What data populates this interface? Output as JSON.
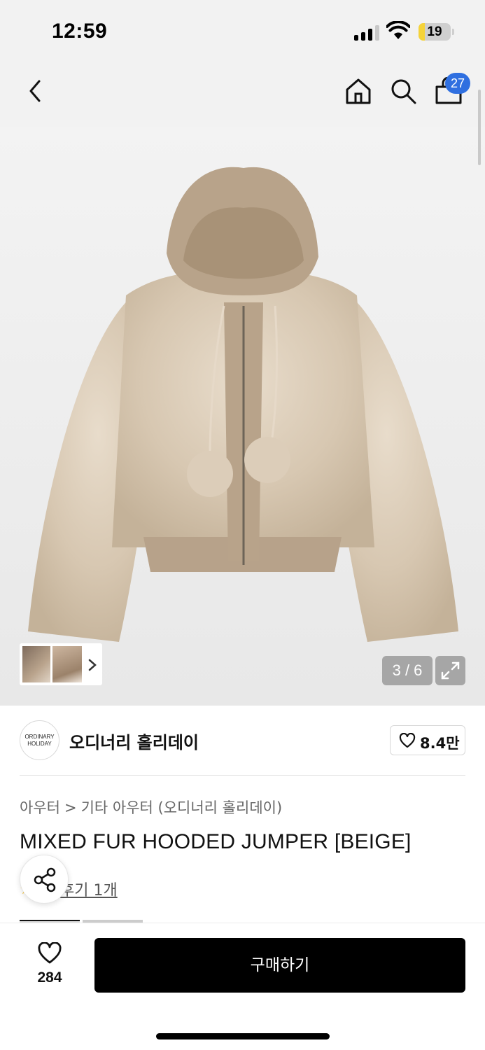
{
  "status_bar": {
    "time": "12:59",
    "battery_level": "19",
    "battery_percent": 19,
    "battery_color": "#f5d33a"
  },
  "nav": {
    "back_icon": "chevron-left-icon",
    "home_icon": "home-icon",
    "search_icon": "search-icon",
    "cart_icon": "shopping-bag-icon",
    "cart_count": "27",
    "badge_color": "#2f6fe0"
  },
  "gallery": {
    "page_indicator": "3 / 6",
    "current_page": 3,
    "total_pages": 6,
    "expand_icon": "expand-icon",
    "thumb_arrow_icon": "chevron-right-icon"
  },
  "brand": {
    "logo_line1": "ORDINARY",
    "logo_line2": "HOLIDAY",
    "name": "오디너리 홀리데이",
    "like_count": "8.4만"
  },
  "product": {
    "breadcrumb_category": "아우터",
    "breadcrumb_separator": ">",
    "breadcrumb_subcategory": "기타 아우터 (오디너리 홀리데이)",
    "title": "MIXED FUR HOODED JUMPER [BEIGE]",
    "review_link": "후기 1개",
    "share_icon": "share-icon"
  },
  "bottom_bar": {
    "like_count": "284",
    "buy_label": "구매하기",
    "heart_icon": "heart-icon"
  }
}
